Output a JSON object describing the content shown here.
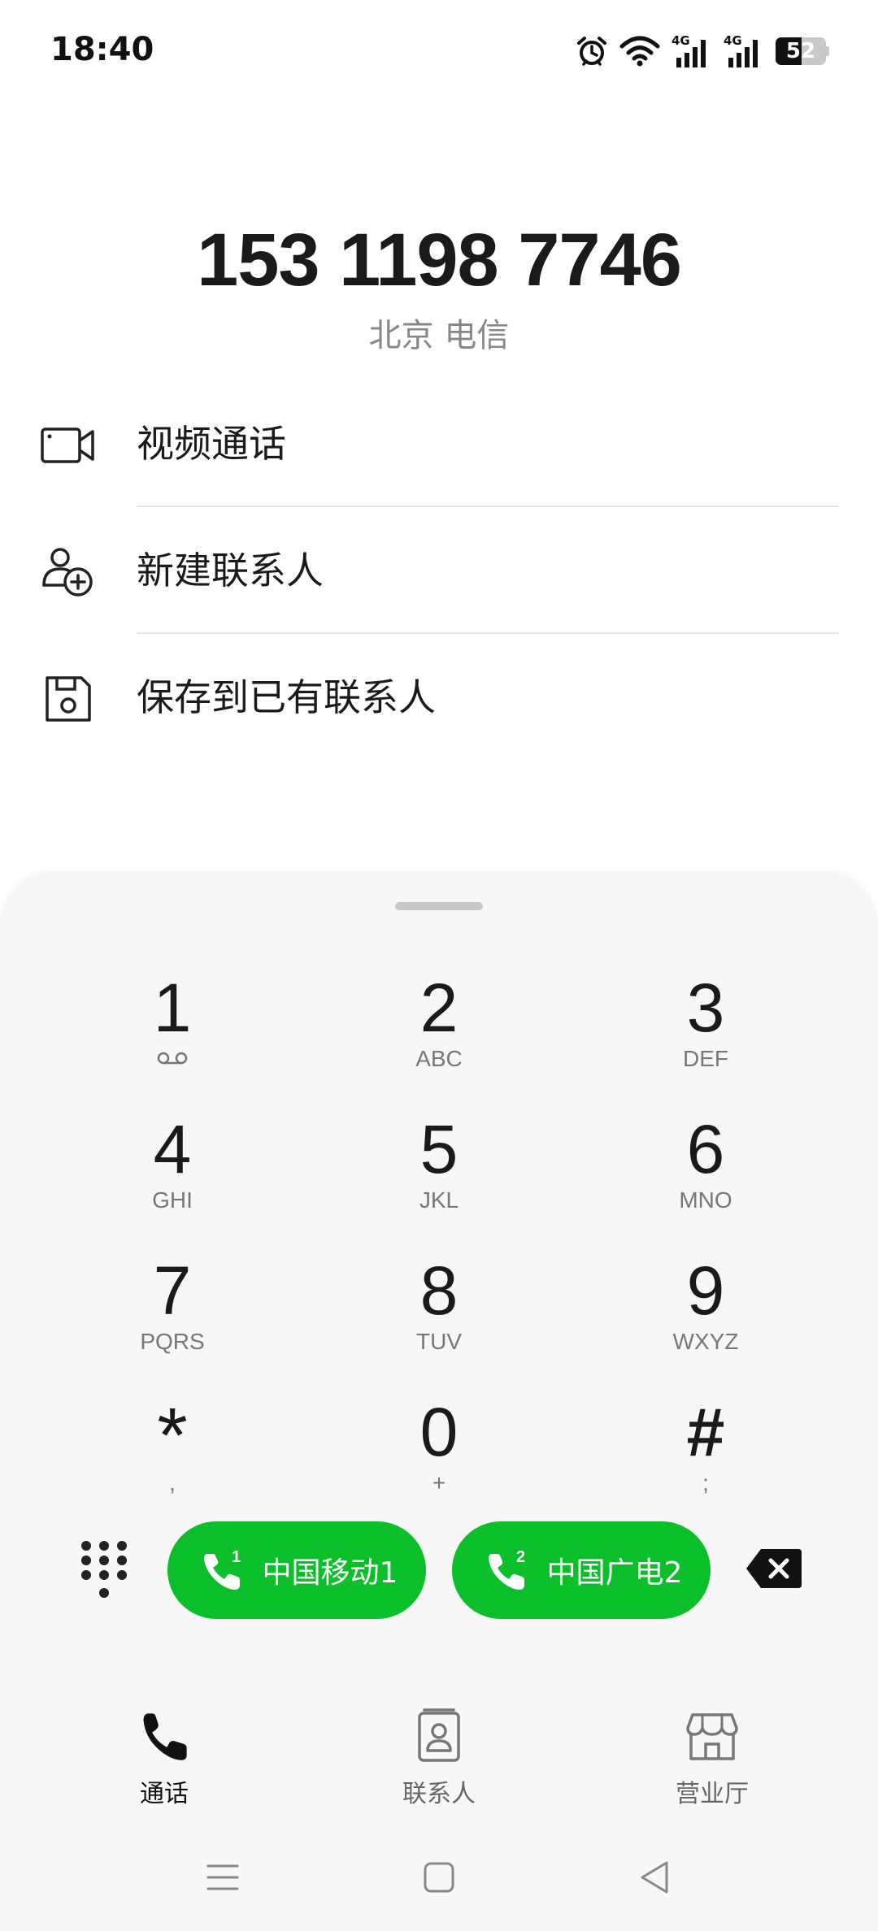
{
  "status_bar": {
    "time": "18:40",
    "icons": [
      "alarm-icon",
      "wifi-icon",
      "signal-4g-sim1-icon",
      "signal-4g-sim2-icon"
    ],
    "network_label_1": "4G",
    "network_label_2": "4G",
    "battery_level": "52",
    "battery_percent": 52
  },
  "header": {
    "phone_number": "153 1198 7746",
    "location": "北京 电信"
  },
  "actions": [
    {
      "label": "视频通话",
      "icon": "video-camera-icon"
    },
    {
      "label": "新建联系人",
      "icon": "add-contact-icon"
    },
    {
      "label": "保存到已有联系人",
      "icon": "save-icon"
    }
  ],
  "dialpad": {
    "keys": [
      {
        "digit": "1",
        "letters": ""
      },
      {
        "digit": "2",
        "letters": "ABC"
      },
      {
        "digit": "3",
        "letters": "DEF"
      },
      {
        "digit": "4",
        "letters": "GHI"
      },
      {
        "digit": "5",
        "letters": "JKL"
      },
      {
        "digit": "6",
        "letters": "MNO"
      },
      {
        "digit": "7",
        "letters": "PQRS"
      },
      {
        "digit": "8",
        "letters": "TUV"
      },
      {
        "digit": "9",
        "letters": "WXYZ"
      },
      {
        "digit": "*",
        "letters": ","
      },
      {
        "digit": "0",
        "letters": "+"
      },
      {
        "digit": "#",
        "letters": ";"
      }
    ],
    "sim1": {
      "label": "中国移动1",
      "badge": "1"
    },
    "sim2": {
      "label": "中国广电2",
      "badge": "2"
    }
  },
  "bottom_nav": [
    {
      "label": "通话",
      "icon": "phone-icon",
      "active": true
    },
    {
      "label": "联系人",
      "icon": "contacts-icon",
      "active": false
    },
    {
      "label": "营业厅",
      "icon": "store-icon",
      "active": false
    }
  ],
  "colors": {
    "accent_green": "#0bbf2a",
    "panel_background": "#f7f7f7",
    "text_primary": "#1a1a1a",
    "text_secondary": "#888888"
  }
}
